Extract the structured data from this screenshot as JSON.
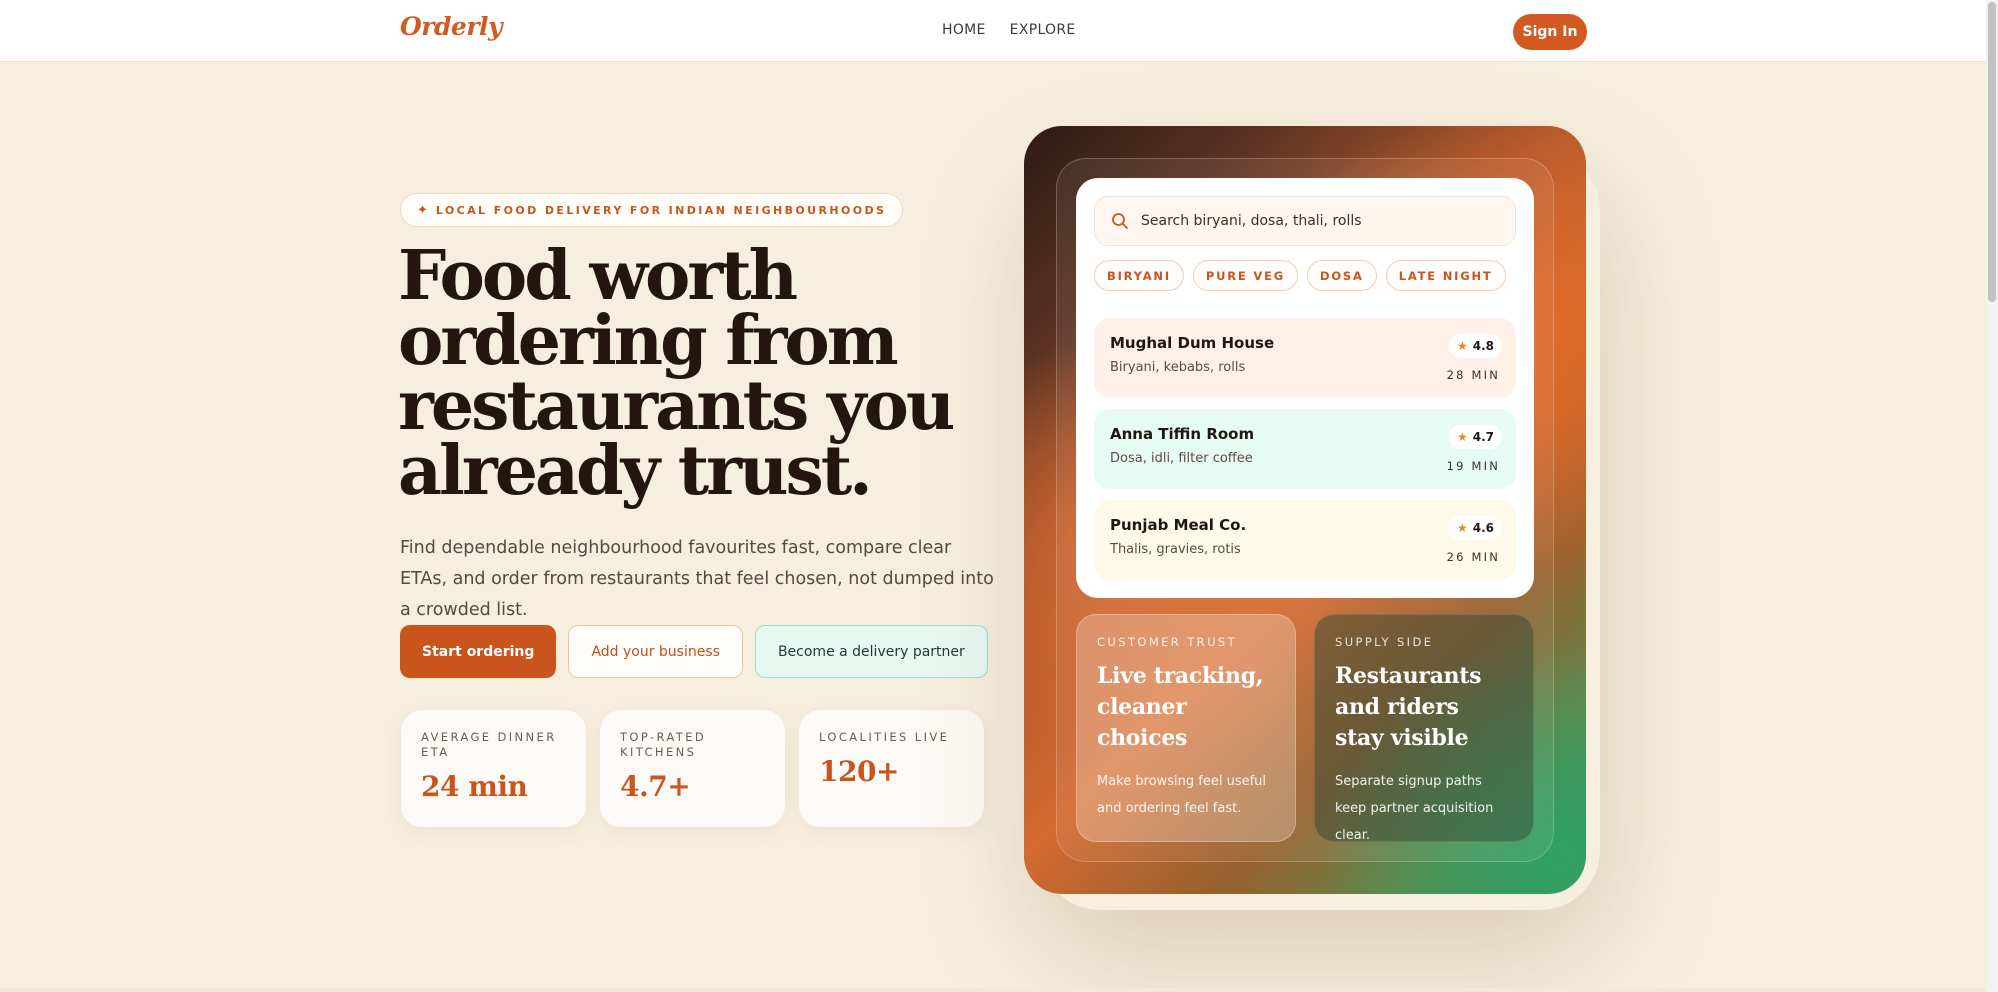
{
  "nav": {
    "logo": "Orderly",
    "links": [
      "HOME",
      "EXPLORE"
    ],
    "signin_label": "Sign In"
  },
  "hero": {
    "eyebrow": "LOCAL FOOD DELIVERY FOR INDIAN NEIGHBOURHOODS",
    "headline_lines": [
      "Food worth",
      "ordering from",
      "restaurants you",
      "already trust."
    ],
    "subcopy": "Find dependable neighbourhood favourites fast, compare clear ETAs, and order from restaurants that feel chosen, not dumped into a crowded list.",
    "cta": {
      "primary": "Start ordering",
      "business": "Add your business",
      "partner": "Become a delivery partner"
    },
    "stats": [
      {
        "label": "AVERAGE DINNER ETA",
        "value": "24 min"
      },
      {
        "label": "TOP-RATED KITCHENS",
        "value": "4.7+"
      },
      {
        "label": "LOCALITIES LIVE",
        "value": "120+"
      }
    ]
  },
  "card": {
    "search_placeholder": "Search biryani, dosa, thali, rolls",
    "chips": [
      "BIRYANI",
      "PURE VEG",
      "DOSA",
      "LATE NIGHT"
    ],
    "restaurants": [
      {
        "name": "Mughal Dum House",
        "cuisine": "Biryani, kebabs, rolls",
        "rating": "4.8",
        "eta": "28 MIN"
      },
      {
        "name": "Anna Tiffin Room",
        "cuisine": "Dosa, idli, filter coffee",
        "rating": "4.7",
        "eta": "19 MIN"
      },
      {
        "name": "Punjab Meal Co.",
        "cuisine": "Thalis, gravies, rotis",
        "rating": "4.6",
        "eta": "26 MIN"
      }
    ],
    "features": [
      {
        "label": "CUSTOMER TRUST",
        "title": "Live tracking, cleaner choices",
        "body": "Make browsing feel useful and ordering feel fast."
      },
      {
        "label": "SUPPLY SIDE",
        "title": "Restaurants and riders stay visible",
        "body": "Separate signup paths keep partner acquisition clear."
      }
    ]
  },
  "icons": {
    "eyebrow": "sparkle-icon",
    "search": "search-icon",
    "rating": "star-icon"
  },
  "colors": {
    "accent": "#d25a20",
    "background": "#f6eedf",
    "headline": "#24160f"
  }
}
